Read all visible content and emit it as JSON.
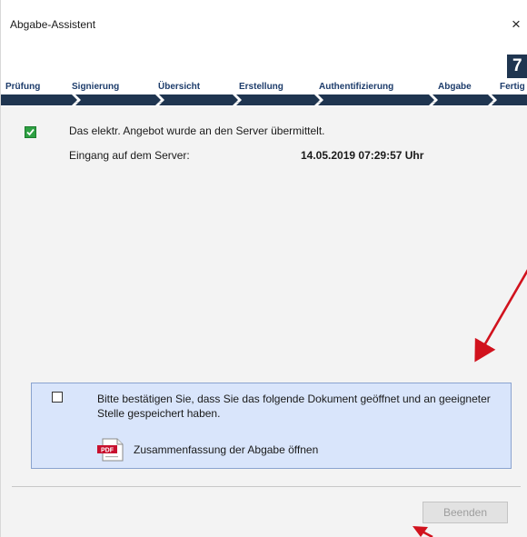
{
  "window": {
    "title": "Abgabe-Assistent",
    "close_symbol": "×",
    "step_number": "7"
  },
  "steps": [
    {
      "label": "Prüfung"
    },
    {
      "label": "Signierung"
    },
    {
      "label": "Übersicht"
    },
    {
      "label": "Erstellung"
    },
    {
      "label": "Authentifizierung"
    },
    {
      "label": "Abgabe"
    },
    {
      "label": "Fertig"
    }
  ],
  "status": {
    "message": "Das elektr. Angebot wurde an den Server übermittelt.",
    "receipt_label": "Eingang auf dem Server:",
    "receipt_value": "14.05.2019 07:29:57 Uhr",
    "check_icon": "check-icon",
    "check_color": "#2ea043"
  },
  "confirm": {
    "text": "Bitte bestätigen Sie, dass Sie das folgende Dokument geöffnet und an geeigneter Stelle gespeichert haben.",
    "pdf_badge": "PDF",
    "link_label": "Zusammenfassung der Abgabe öffnen",
    "panel_color": "#d9e5fb"
  },
  "footer": {
    "finish_label": "Beenden"
  },
  "colors": {
    "step_text": "#1d3c6b",
    "step_arrows": "#1f3550",
    "annotation_arrows": "#d1121d"
  }
}
